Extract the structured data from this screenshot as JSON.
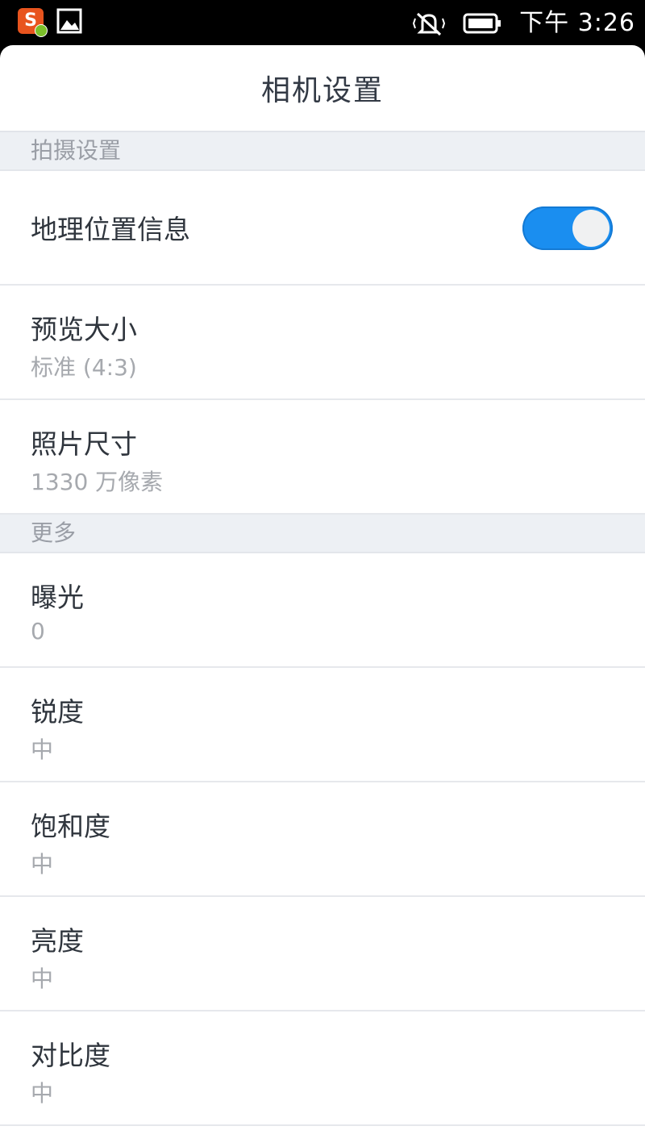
{
  "status_bar": {
    "time": "下午 3:26",
    "notification_icons": [
      "sogou-input-icon",
      "image-icon"
    ],
    "system_icons": [
      "silent-bell-icon",
      "battery-icon"
    ]
  },
  "header": {
    "title": "相机设置"
  },
  "sections": [
    {
      "title": "拍摄设置",
      "items": [
        {
          "label": "地理位置信息",
          "toggle": true
        },
        {
          "label": "预览大小",
          "value": "标准 (4:3)"
        },
        {
          "label": "照片尺寸",
          "value": "1330 万像素"
        }
      ]
    },
    {
      "title": "更多",
      "items": [
        {
          "label": "曝光",
          "value": "0"
        },
        {
          "label": "锐度",
          "value": "中"
        },
        {
          "label": "饱和度",
          "value": "中"
        },
        {
          "label": "亮度",
          "value": "中"
        },
        {
          "label": "对比度",
          "value": "中"
        }
      ]
    }
  ],
  "colors": {
    "accent": "#1a8ef0",
    "section_bg": "#edf0f4",
    "title_text": "#333a45",
    "sub_text": "#a6a9ae"
  }
}
